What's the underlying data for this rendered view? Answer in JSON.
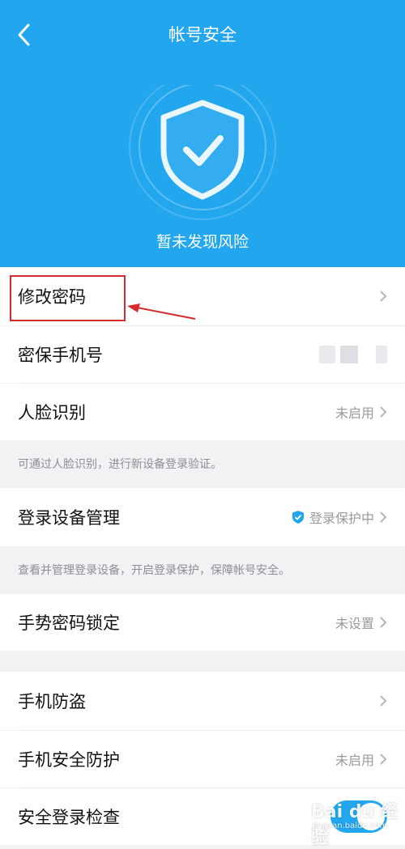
{
  "header": {
    "title": "帐号安全",
    "status": "暂未发现风险"
  },
  "items": {
    "change_password": {
      "label": "修改密码"
    },
    "secure_phone": {
      "label": "密保手机号"
    },
    "face_id": {
      "label": "人脸识别",
      "value": "未启用"
    },
    "face_note": "可通过人脸识别，进行新设备登录验证。",
    "device_mgmt": {
      "label": "登录设备管理",
      "value": "登录保护中"
    },
    "device_note": "查看并管理登录设备，开启登录保护，保障帐号安全。",
    "gesture_lock": {
      "label": "手势密码锁定",
      "value": "未设置"
    },
    "anti_theft": {
      "label": "手机防盗"
    },
    "phone_protect": {
      "label": "手机安全防护",
      "value": "未启用"
    },
    "login_check": {
      "label": "安全登录检查",
      "enabled": true
    }
  },
  "watermark": {
    "text": "Bai du 经验",
    "sub": "jingyan.baidu.com"
  },
  "colors": {
    "accent": "#22a6ee",
    "highlight": "#d52b2b"
  }
}
